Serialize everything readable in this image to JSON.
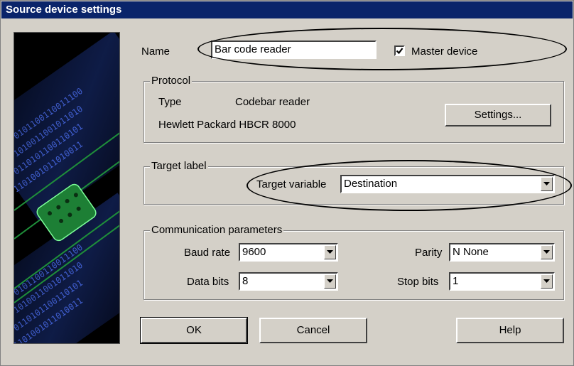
{
  "window": {
    "title": "Source device settings"
  },
  "name": {
    "label": "Name",
    "value": "Bar code reader"
  },
  "master_device": {
    "label": "Master device",
    "checked": true
  },
  "protocol": {
    "legend": "Protocol",
    "type_label": "Type",
    "type_value": "Codebar reader",
    "device": "Hewlett Packard HBCR 8000",
    "settings_button": "Settings..."
  },
  "target_label": {
    "legend": "Target label",
    "variable_label": "Target variable",
    "variable_value": "Destination"
  },
  "comm": {
    "legend": "Communication parameters",
    "baud_label": "Baud rate",
    "baud_value": "9600",
    "data_bits_label": "Data bits",
    "data_bits_value": "8",
    "parity_label": "Parity",
    "parity_value": "N None",
    "stop_bits_label": "Stop bits",
    "stop_bits_value": "1"
  },
  "buttons": {
    "ok": "OK",
    "cancel": "Cancel",
    "help": "Help"
  },
  "colors": {
    "titlebar": "#0a246a",
    "dialog_bg": "#d4d0c8",
    "circuit_green": "#1f8f3a"
  }
}
